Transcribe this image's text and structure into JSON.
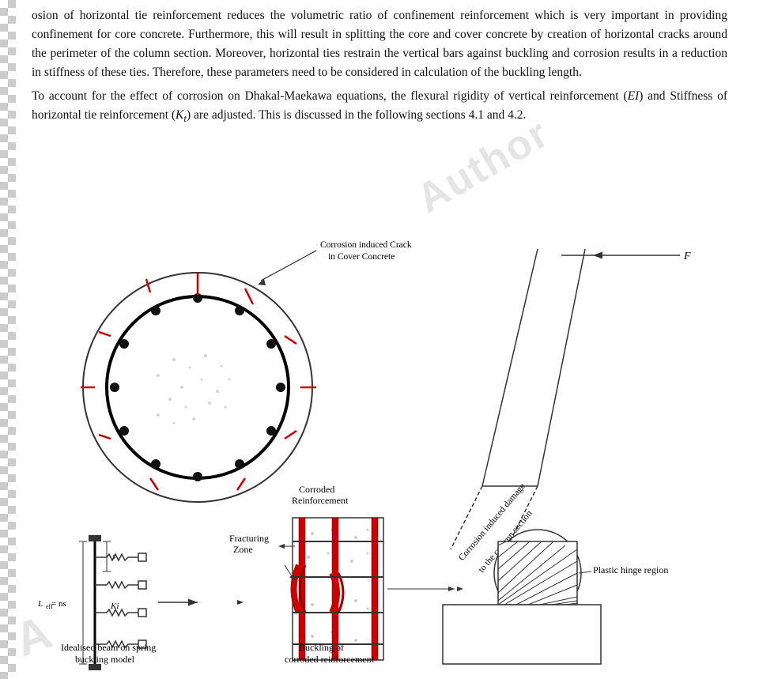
{
  "text": {
    "paragraph1": "osion of horizontal tie reinforcement reduces the volumetric ratio of confinement reinforcement which is very important in providing confinement for core concrete. Furthermore, this will result in splitting the core and cover concrete by creation of horizontal cracks around the perimeter of the column section. Moreover, horizontal ties restrain the vertical bars against buckling and corrosion results in a reduction in stiffness of these ties. Therefore, these parameters need to be considered in calculation of the buckling length.",
    "paragraph2": "To account for the effect of corrosion on Dhakal-Maekawa equations, the flexural rigidity of vertical reinforcement (EI) and Stiffness of horizontal tie reinforcement (Kt) are adjusted. This is discussed in the following sections 4.1 and 4.2.",
    "label_corrosion_crack": "Corrosion induced Crack in Cover Concrete",
    "label_F": "F",
    "label_corroded": "Corroded Reinforcement",
    "label_fracturing": "Fracturing Zone",
    "label_corrosion_damage": "Corrosion induced damage to the column section",
    "label_plastic_hinge": "Plastic hinge region",
    "label_leff": "L_eff = ns",
    "label_Ki": "Ki",
    "label_s": "s",
    "label_idealised": "Idealised  beam on spring buckling model",
    "label_buckling": "Buckling of corroded reinforcement"
  }
}
